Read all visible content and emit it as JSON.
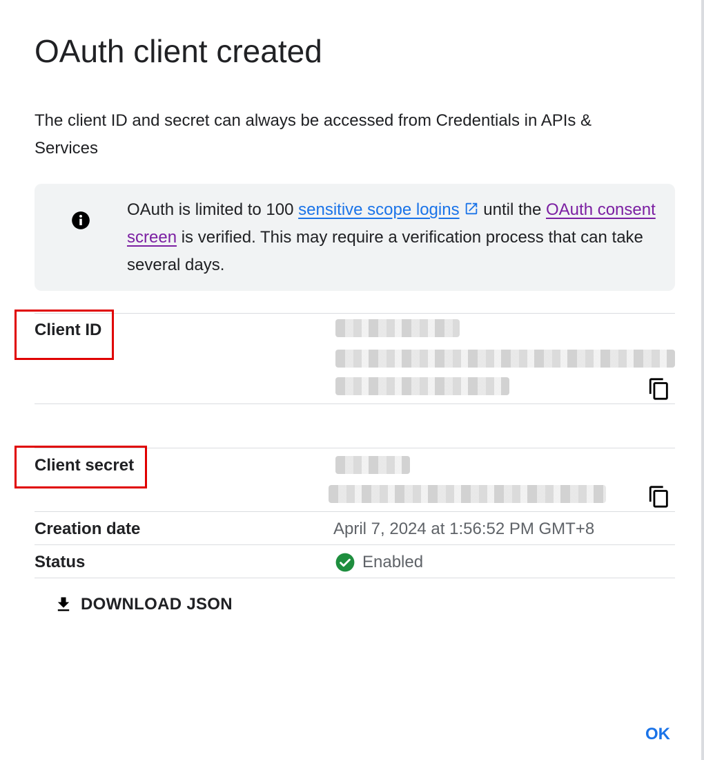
{
  "dialog": {
    "title": "OAuth client created",
    "description": "The client ID and secret can always be accessed from Credentials in APIs & Services"
  },
  "info": {
    "icon": "info-icon",
    "text_before": "OAuth is limited to 100 ",
    "link1": "sensitive scope logins",
    "text_middle": " until the ",
    "link2": "OAuth consent screen",
    "text_after": " is verified. This may require a verification process that can take several days."
  },
  "fields": {
    "client_id_label": "Client ID",
    "client_secret_label": "Client secret",
    "creation_date_label": "Creation date",
    "creation_date_value": "April 7, 2024 at 1:56:52 PM GMT+8",
    "status_label": "Status",
    "status_value": "Enabled"
  },
  "actions": {
    "download_label": "DOWNLOAD JSON",
    "ok_label": "OK"
  },
  "colors": {
    "accent": "#1a73e8",
    "visited_link": "#7b1fa2",
    "success": "#1e8e3e",
    "highlight_box": "#e00000"
  }
}
